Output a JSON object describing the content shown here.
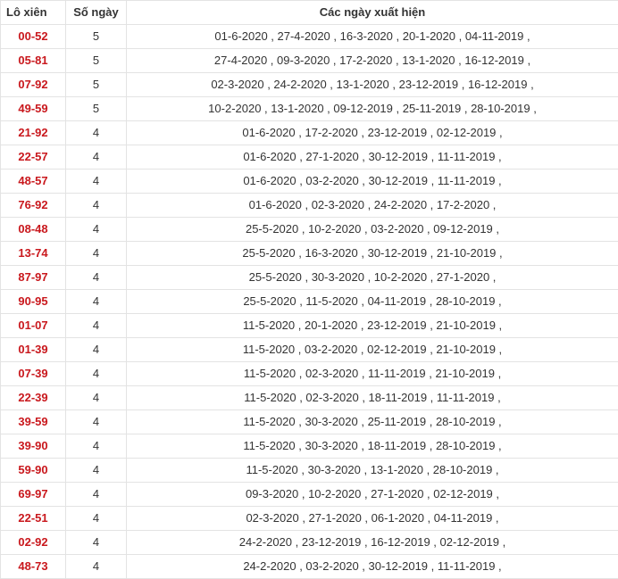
{
  "header": {
    "col_pair": "Lô xiên",
    "col_count": "Số ngày",
    "col_dates": "Các ngày xuất hiện"
  },
  "rows": [
    {
      "pair": "00-52",
      "count": "5",
      "dates": "01-6-2020 , 27-4-2020 , 16-3-2020 , 20-1-2020 , 04-11-2019 ,"
    },
    {
      "pair": "05-81",
      "count": "5",
      "dates": "27-4-2020 , 09-3-2020 , 17-2-2020 , 13-1-2020 , 16-12-2019 ,"
    },
    {
      "pair": "07-92",
      "count": "5",
      "dates": "02-3-2020 , 24-2-2020 , 13-1-2020 , 23-12-2019 , 16-12-2019 ,"
    },
    {
      "pair": "49-59",
      "count": "5",
      "dates": "10-2-2020 , 13-1-2020 , 09-12-2019 , 25-11-2019 , 28-10-2019 ,"
    },
    {
      "pair": "21-92",
      "count": "4",
      "dates": "01-6-2020 , 17-2-2020 , 23-12-2019 , 02-12-2019 ,"
    },
    {
      "pair": "22-57",
      "count": "4",
      "dates": "01-6-2020 , 27-1-2020 , 30-12-2019 , 11-11-2019 ,"
    },
    {
      "pair": "48-57",
      "count": "4",
      "dates": "01-6-2020 , 03-2-2020 , 30-12-2019 , 11-11-2019 ,"
    },
    {
      "pair": "76-92",
      "count": "4",
      "dates": "01-6-2020 , 02-3-2020 , 24-2-2020 , 17-2-2020 ,"
    },
    {
      "pair": "08-48",
      "count": "4",
      "dates": "25-5-2020 , 10-2-2020 , 03-2-2020 , 09-12-2019 ,"
    },
    {
      "pair": "13-74",
      "count": "4",
      "dates": "25-5-2020 , 16-3-2020 , 30-12-2019 , 21-10-2019 ,"
    },
    {
      "pair": "87-97",
      "count": "4",
      "dates": "25-5-2020 , 30-3-2020 , 10-2-2020 , 27-1-2020 ,"
    },
    {
      "pair": "90-95",
      "count": "4",
      "dates": "25-5-2020 , 11-5-2020 , 04-11-2019 , 28-10-2019 ,"
    },
    {
      "pair": "01-07",
      "count": "4",
      "dates": "11-5-2020 , 20-1-2020 , 23-12-2019 , 21-10-2019 ,"
    },
    {
      "pair": "01-39",
      "count": "4",
      "dates": "11-5-2020 , 03-2-2020 , 02-12-2019 , 21-10-2019 ,"
    },
    {
      "pair": "07-39",
      "count": "4",
      "dates": "11-5-2020 , 02-3-2020 , 11-11-2019 , 21-10-2019 ,"
    },
    {
      "pair": "22-39",
      "count": "4",
      "dates": "11-5-2020 , 02-3-2020 , 18-11-2019 , 11-11-2019 ,"
    },
    {
      "pair": "39-59",
      "count": "4",
      "dates": "11-5-2020 , 30-3-2020 , 25-11-2019 , 28-10-2019 ,"
    },
    {
      "pair": "39-90",
      "count": "4",
      "dates": "11-5-2020 , 30-3-2020 , 18-11-2019 , 28-10-2019 ,"
    },
    {
      "pair": "59-90",
      "count": "4",
      "dates": "11-5-2020 , 30-3-2020 , 13-1-2020 , 28-10-2019 ,"
    },
    {
      "pair": "69-97",
      "count": "4",
      "dates": "09-3-2020 , 10-2-2020 , 27-1-2020 , 02-12-2019 ,"
    },
    {
      "pair": "22-51",
      "count": "4",
      "dates": "02-3-2020 , 27-1-2020 , 06-1-2020 , 04-11-2019 ,"
    },
    {
      "pair": "02-92",
      "count": "4",
      "dates": "24-2-2020 , 23-12-2019 , 16-12-2019 , 02-12-2019 ,"
    },
    {
      "pair": "48-73",
      "count": "4",
      "dates": "24-2-2020 , 03-2-2020 , 30-12-2019 , 11-11-2019 ,"
    }
  ],
  "colors": {
    "pair_text": "#c9181d",
    "body_text": "#333333",
    "border": "#e3e3e3"
  }
}
